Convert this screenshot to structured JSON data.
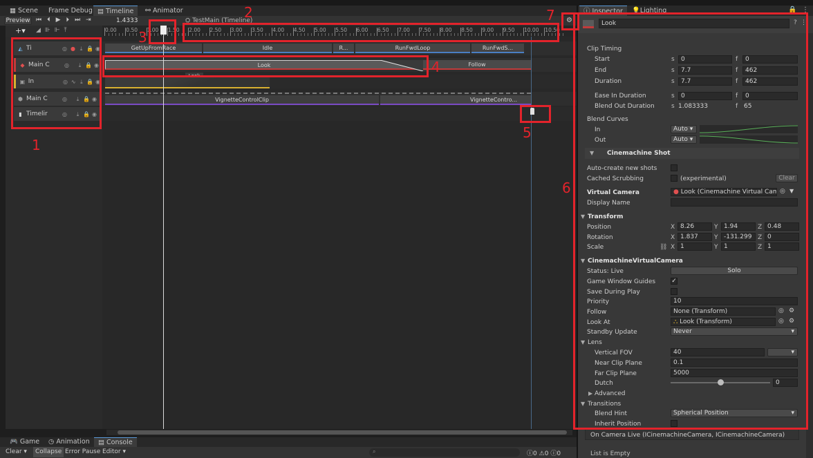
{
  "tabs": {
    "scene": "Scene",
    "frame_debug": "Frame Debug",
    "timeline": "Timeline",
    "animator": "Animator",
    "inspector": "Inspector",
    "lighting": "Lighting"
  },
  "timeline": {
    "preview": "Preview",
    "time": "1.4333",
    "asset_title": "TestMain (Timeline)",
    "ruler": [
      "0.00",
      "0.50",
      "1.00",
      "1.50",
      "2.00",
      "2.50",
      "3.00",
      "3.50",
      "4.00",
      "4.50",
      "5.00",
      "5.50",
      "6.00",
      "6.50",
      "7.00",
      "7.50",
      "8.00",
      "8.50",
      "9.00",
      "9.50",
      "10.00",
      "10.50"
    ],
    "tracks": [
      {
        "label": "Ti"
      },
      {
        "label": "Main C"
      },
      {
        "label": "In"
      },
      {
        "label": "Main C"
      },
      {
        "label": "Timelir"
      }
    ],
    "clips": {
      "get_up": "GetUpFromRace",
      "idle": "Idle",
      "r": "R...",
      "run_loop": "RunFwdLoop",
      "run_s": "RunFwdS...",
      "look": "Look",
      "follow": "Follow",
      "look_small": "Look",
      "vignette1": "VignetteControlClip",
      "vignette2": "VignetteContro..."
    }
  },
  "annotations": [
    "1",
    "2",
    "3",
    "4",
    "5",
    "6",
    "7"
  ],
  "bottom": {
    "game": "Game",
    "animation": "Animation",
    "console": "Console",
    "clear": "Clear",
    "collapse": "Collapse",
    "error_pause": "Error Pause",
    "editor": "Editor",
    "c0": "0",
    "c1": "0",
    "c2": "0"
  },
  "inspector": {
    "title": "Look",
    "clip_timing": "Clip Timing",
    "start": "Start",
    "end": "End",
    "duration": "Duration",
    "ease_in": "Ease In Duration",
    "blend_out": "Blend Out Duration",
    "s_lbl": "s",
    "f_lbl": "f",
    "start_s": "0",
    "start_f": "0",
    "end_s": "7.7",
    "end_f": "462",
    "dur_s": "7.7",
    "dur_f": "462",
    "ease_s": "0",
    "ease_f": "0",
    "blend_s": "1.083333",
    "blend_f": "65",
    "blend_curves": "Blend Curves",
    "in": "In",
    "out": "Out",
    "auto": "Auto",
    "cm_shot": "Cinemachine Shot",
    "auto_create": "Auto-create new shots",
    "cached": "Cached Scrubbing",
    "experimental": "(experimental)",
    "clear_btn": "Clear",
    "vcam": "Virtual Camera",
    "vcam_val": "Look (Cinemachine Virtual Camera",
    "display_name": "Display Name",
    "transform": "Transform",
    "position": "Position",
    "rotation": "Rotation",
    "scale": "Scale",
    "pos": [
      "8.26",
      "1.94",
      "0.48"
    ],
    "rot": [
      "1.837",
      "-131.299",
      "0"
    ],
    "scl": [
      "1",
      "1",
      "1"
    ],
    "x": "X",
    "y": "Y",
    "z": "Z",
    "cvc": "CinemachineVirtualCamera",
    "status": "Status: Live",
    "solo": "Solo",
    "guides": "Game Window Guides",
    "save_play": "Save During Play",
    "priority": "Priority",
    "priority_val": "10",
    "follow": "Follow",
    "follow_val": "None (Transform)",
    "look_at": "Look At",
    "look_at_val": "Look (Transform)",
    "standby": "Standby Update",
    "standby_val": "Never",
    "lens": "Lens",
    "vfov": "Vertical FOV",
    "vfov_val": "40",
    "near": "Near Clip Plane",
    "near_val": "0.1",
    "far": "Far Clip Plane",
    "far_val": "5000",
    "dutch": "Dutch",
    "dutch_val": "0",
    "advanced": "Advanced",
    "transitions": "Transitions",
    "blend_hint": "Blend Hint",
    "blend_hint_val": "Spherical Position",
    "inherit": "Inherit Position",
    "on_live": "On Camera Live (ICinemachineCamera, ICinemachineCamera)",
    "list_empty": "List is Empty"
  },
  "colors": {
    "annotation": "#e3232b",
    "anim_track": "#4a7fc4",
    "cine_track": "#c23a3a",
    "vignette_track": "#7a4ac4"
  }
}
